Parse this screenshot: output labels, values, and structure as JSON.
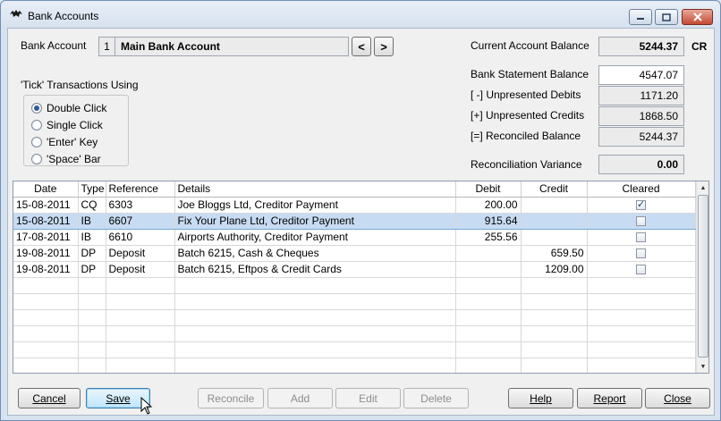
{
  "window": {
    "title": "Bank Accounts",
    "icon": "bat-icon"
  },
  "bank_account": {
    "label": "Bank Account",
    "number": "1",
    "name": "Main Bank Account",
    "prev_label": "<",
    "next_label": ">"
  },
  "tick_options": {
    "title": "'Tick' Transactions Using",
    "options": [
      {
        "label": "Double Click",
        "selected": true
      },
      {
        "label": "Single Click",
        "selected": false
      },
      {
        "label": "'Enter' Key",
        "selected": false
      },
      {
        "label": "'Space' Bar",
        "selected": false
      }
    ]
  },
  "balances": {
    "current_label": "Current Account Balance",
    "current_value": "5244.37",
    "current_suffix": "CR",
    "statement_label": "Bank Statement Balance",
    "statement_value": "4547.07",
    "unpresented_debits_label": "[ -] Unpresented Debits",
    "unpresented_debits_value": "1171.20",
    "unpresented_credits_label": "[+] Unpresented Credits",
    "unpresented_credits_value": "1868.50",
    "reconciled_label": "[=] Reconciled Balance",
    "reconciled_value": "5244.37",
    "variance_label": "Reconciliation Variance",
    "variance_value": "0.00"
  },
  "table": {
    "columns": [
      "Date",
      "Type",
      "Reference",
      "Details",
      "Debit",
      "Credit",
      "Cleared"
    ],
    "rows": [
      {
        "date": "15-08-2011",
        "type": "CQ",
        "reference": "6303",
        "details": "Joe Bloggs Ltd, Creditor Payment",
        "debit": "200.00",
        "credit": "",
        "cleared": true
      },
      {
        "date": "15-08-2011",
        "type": "IB",
        "reference": "6607",
        "details": "Fix Your Plane Ltd, Creditor Payment",
        "debit": "915.64",
        "credit": "",
        "cleared": false
      },
      {
        "date": "17-08-2011",
        "type": "IB",
        "reference": "6610",
        "details": "Airports Authority, Creditor Payment",
        "debit": "255.56",
        "credit": "",
        "cleared": false
      },
      {
        "date": "19-08-2011",
        "type": "DP",
        "reference": "Deposit",
        "details": "Batch 6215, Cash & Cheques",
        "debit": "",
        "credit": "659.50",
        "cleared": false
      },
      {
        "date": "19-08-2011",
        "type": "DP",
        "reference": "Deposit",
        "details": "Batch 6215, Eftpos & Credit Cards",
        "debit": "",
        "credit": "1209.00",
        "cleared": false
      }
    ],
    "selected_row": 1
  },
  "buttons": {
    "cancel": "Cancel",
    "save": "Save",
    "reconcile": "Reconcile",
    "add": "Add",
    "edit": "Edit",
    "delete": "Delete",
    "help": "Help",
    "report": "Report",
    "close": "Close"
  },
  "colors": {
    "selection": "#c7dcf2",
    "title_bar": "#d7e2ef",
    "close_button": "#c24a33"
  }
}
